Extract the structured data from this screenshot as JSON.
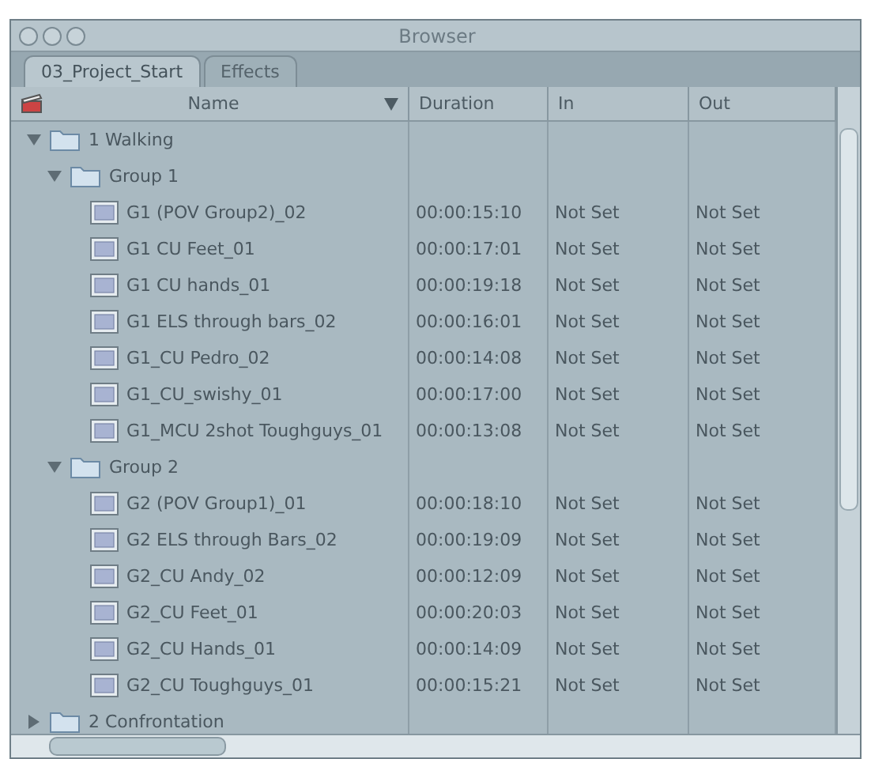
{
  "window": {
    "title": "Browser"
  },
  "tabs": [
    {
      "label": "03_Project_Start",
      "selected": true
    },
    {
      "label": "Effects",
      "selected": false
    }
  ],
  "columns": [
    "Name",
    "Duration",
    "In",
    "Out"
  ],
  "items": [
    {
      "kind": "bin",
      "name": "1 Walking",
      "expanded": true,
      "children": [
        {
          "kind": "bin",
          "name": "Group 1",
          "expanded": true,
          "children": [
            {
              "kind": "clip",
              "name": "G1 (POV Group2)_02",
              "duration": "00:00:15:10",
              "in": "Not Set",
              "out": "Not Set"
            },
            {
              "kind": "clip",
              "name": "G1 CU Feet_01",
              "duration": "00:00:17:01",
              "in": "Not Set",
              "out": "Not Set"
            },
            {
              "kind": "clip",
              "name": "G1 CU hands_01",
              "duration": "00:00:19:18",
              "in": "Not Set",
              "out": "Not Set"
            },
            {
              "kind": "clip",
              "name": "G1 ELS through bars_02",
              "duration": "00:00:16:01",
              "in": "Not Set",
              "out": "Not Set"
            },
            {
              "kind": "clip",
              "name": "G1_CU Pedro_02",
              "duration": "00:00:14:08",
              "in": "Not Set",
              "out": "Not Set"
            },
            {
              "kind": "clip",
              "name": "G1_CU_swishy_01",
              "duration": "00:00:17:00",
              "in": "Not Set",
              "out": "Not Set"
            },
            {
              "kind": "clip",
              "name": "G1_MCU 2shot Toughguys_01",
              "duration": "00:00:13:08",
              "in": "Not Set",
              "out": "Not Set"
            }
          ]
        },
        {
          "kind": "bin",
          "name": "Group 2",
          "expanded": true,
          "children": [
            {
              "kind": "clip",
              "name": "G2 (POV Group1)_01",
              "duration": "00:00:18:10",
              "in": "Not Set",
              "out": "Not Set"
            },
            {
              "kind": "clip",
              "name": "G2 ELS through Bars_02",
              "duration": "00:00:19:09",
              "in": "Not Set",
              "out": "Not Set"
            },
            {
              "kind": "clip",
              "name": "G2_CU Andy_02",
              "duration": "00:00:12:09",
              "in": "Not Set",
              "out": "Not Set"
            },
            {
              "kind": "clip",
              "name": "G2_CU Feet_01",
              "duration": "00:00:20:03",
              "in": "Not Set",
              "out": "Not Set"
            },
            {
              "kind": "clip",
              "name": "G2_CU Hands_01",
              "duration": "00:00:14:09",
              "in": "Not Set",
              "out": "Not Set"
            },
            {
              "kind": "clip",
              "name": "G2_CU Toughguys_01",
              "duration": "00:00:15:21",
              "in": "Not Set",
              "out": "Not Set"
            }
          ]
        }
      ]
    },
    {
      "kind": "bin",
      "name": "2 Confrontation",
      "expanded": false
    }
  ]
}
